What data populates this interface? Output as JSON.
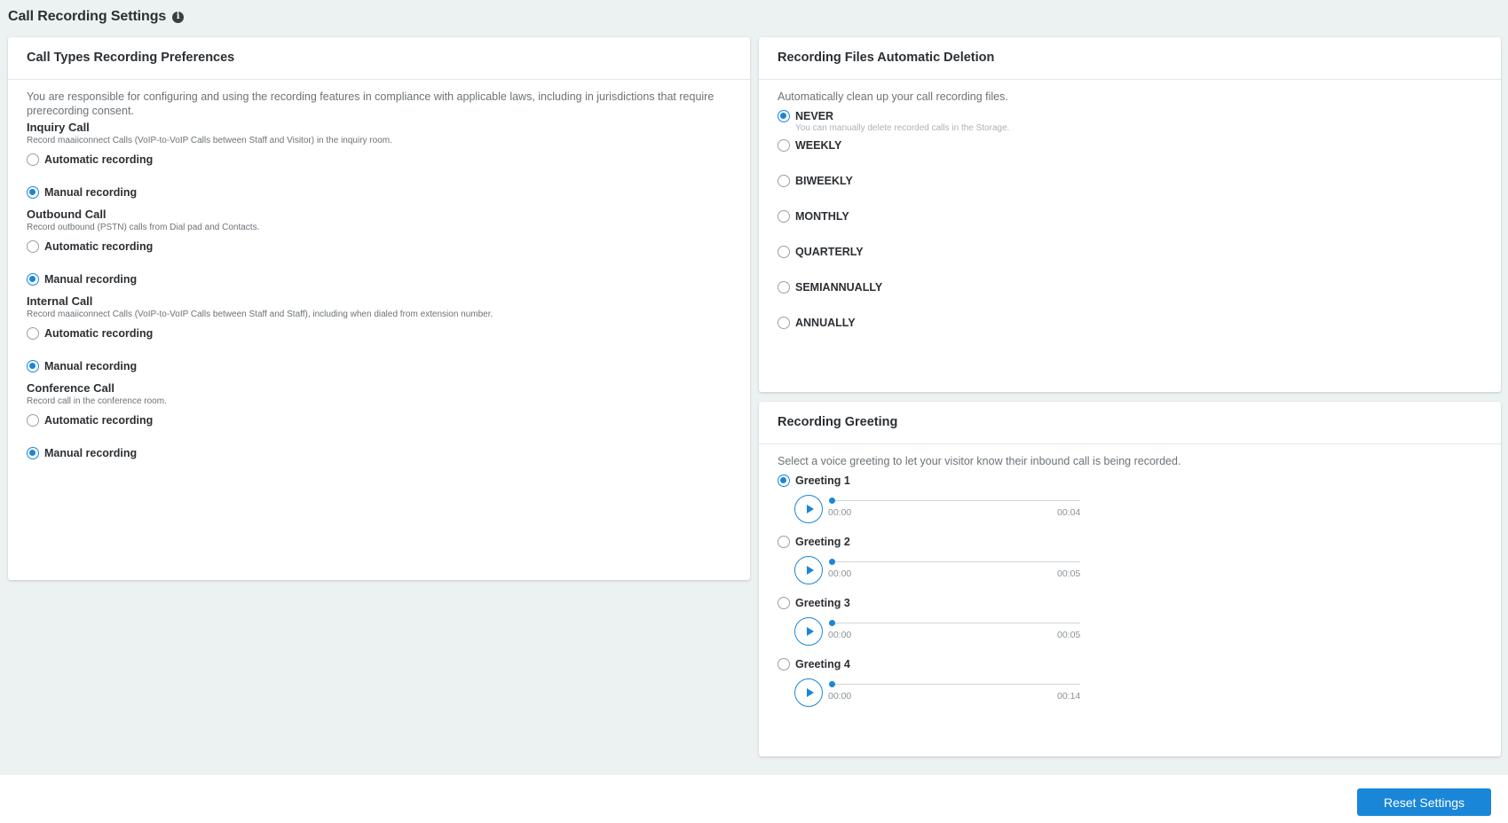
{
  "page": {
    "title": "Call Recording Settings",
    "info_icon": "info-icon"
  },
  "call_types": {
    "title": "Call Types Recording Preferences",
    "intro": "You are responsible for configuring and using the recording features in compliance with applicable laws, including in jurisdictions that require prerecording consent.",
    "sections": [
      {
        "title": "Inquiry Call",
        "desc": "Record maaiiconnect Calls (VoIP-to-VoIP Calls between Staff and Visitor) in the inquiry room.",
        "options": [
          "Automatic recording",
          "Manual recording"
        ],
        "selected": "Manual recording"
      },
      {
        "title": "Outbound Call",
        "desc": "Record outbound (PSTN) calls from Dial pad and Contacts.",
        "options": [
          "Automatic recording",
          "Manual recording"
        ],
        "selected": "Manual recording"
      },
      {
        "title": "Internal Call",
        "desc": "Record maaiiconnect Calls (VoIP-to-VoIP Calls between Staff and Staff), including when dialed from extension number.",
        "options": [
          "Automatic recording",
          "Manual recording"
        ],
        "selected": "Manual recording"
      },
      {
        "title": "Conference Call",
        "desc": "Record call in the conference room.",
        "options": [
          "Automatic recording",
          "Manual recording"
        ],
        "selected": "Manual recording"
      }
    ]
  },
  "deletion": {
    "title": "Recording Files Automatic Deletion",
    "intro": "Automatically clean up your call recording files.",
    "options": [
      "NEVER",
      "WEEKLY",
      "BIWEEKLY",
      "MONTHLY",
      "QUARTERLY",
      "SEMIANNUALLY",
      "ANNUALLY"
    ],
    "selected": "NEVER",
    "never_hint": "You can manually delete recorded calls in the Storage."
  },
  "greeting": {
    "title": "Recording Greeting",
    "intro": "Select a voice greeting to let your visitor know their inbound call is being recorded.",
    "items": [
      {
        "label": "Greeting 1",
        "start": "00:00",
        "end": "00:04",
        "progress": 0
      },
      {
        "label": "Greeting 2",
        "start": "00:00",
        "end": "00:05",
        "progress": 0
      },
      {
        "label": "Greeting 3",
        "start": "00:00",
        "end": "00:05",
        "progress": 0
      },
      {
        "label": "Greeting 4",
        "start": "00:00",
        "end": "00:14",
        "progress": 0
      }
    ],
    "selected": "Greeting 1"
  },
  "footer": {
    "reset_label": "Reset Settings"
  },
  "colors": {
    "accent": "#1a86d8",
    "background": "#ecf1f1"
  }
}
